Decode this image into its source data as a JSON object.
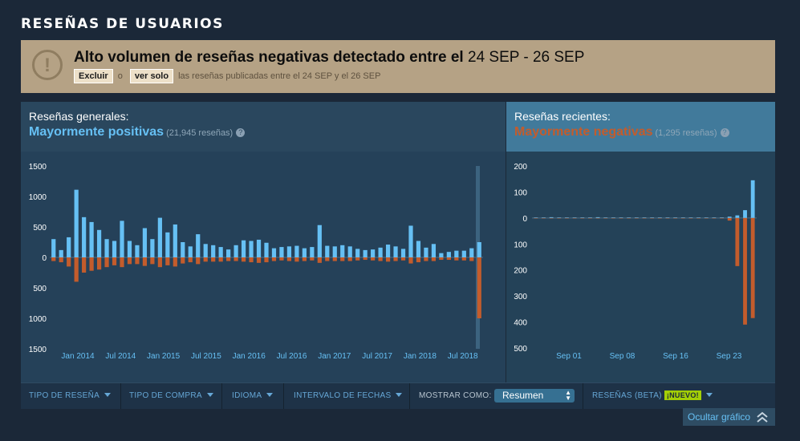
{
  "section_title": "RESEÑAS DE USUARIOS",
  "alert": {
    "title_bold": "Alto volumen de reseñas negativas detectado entre el",
    "title_dates": "24 SEP - 26 SEP",
    "exclude_label": "Excluir",
    "or_label": "o",
    "only_label": "ver solo",
    "suffix": "las reseñas publicadas entre el 24 SEP y el 26 SEP",
    "icon": "exclamation-icon"
  },
  "overall": {
    "label": "Reseñas generales:",
    "summary": "Mayormente positivas",
    "count": "(21,945 reseñas)",
    "help": "?"
  },
  "recent": {
    "label": "Reseñas recientes:",
    "summary": "Mayormente negativas",
    "count": "(1,295 reseñas)",
    "help": "?"
  },
  "colors": {
    "positive": "#66c0f4",
    "negative": "#c35c2c",
    "overall_summary": "#66c0f4",
    "recent_summary": "#c35c2c",
    "new_badge": "#a3cf06"
  },
  "filters": {
    "review_type": "TIPO DE RESEÑA",
    "purchase_type": "TIPO DE COMPRA",
    "language": "IDIOMA",
    "date_range": "INTERVALO DE FECHAS",
    "display_as": "MOSTRAR COMO:",
    "display_value": "Resumen",
    "beta_reviews": "RESEÑAS (BETA)",
    "new_badge": "¡NUEVO!"
  },
  "hide_graph": "Ocultar gráfico",
  "chart_data": [
    {
      "type": "bar",
      "title": "",
      "yticks": [
        "1500",
        "1000",
        "500",
        "0",
        "500",
        "1000",
        "1500"
      ],
      "ylim": [
        -1500,
        1500
      ],
      "xlabels": [
        "Jan 2014",
        "Jul 2014",
        "Jan 2015",
        "Jul 2015",
        "Jan 2016",
        "Jul 2016",
        "Jan 2017",
        "Jul 2017",
        "Jan 2018",
        "Jul 2018"
      ],
      "series": [
        {
          "values": [
            300,
            120,
            330,
            1110,
            660,
            580,
            450,
            300,
            270,
            600,
            270,
            200,
            480,
            300,
            650,
            410,
            540,
            250,
            180,
            380,
            220,
            200,
            170,
            130,
            200,
            280,
            270,
            290,
            240,
            150,
            170,
            180,
            190,
            150,
            170,
            530,
            190,
            180,
            200,
            180,
            140,
            120,
            130,
            160,
            210,
            180,
            140,
            520,
            270,
            160,
            220,
            70,
            90,
            110,
            110,
            150,
            250
          ]
        },
        {
          "values": [
            -60,
            -80,
            -150,
            -400,
            -250,
            -220,
            -200,
            -160,
            -130,
            -160,
            -110,
            -110,
            -140,
            -110,
            -160,
            -130,
            -150,
            -100,
            -80,
            -110,
            -70,
            -70,
            -70,
            -60,
            -60,
            -70,
            -80,
            -90,
            -80,
            -60,
            -50,
            -60,
            -70,
            -60,
            -50,
            -90,
            -60,
            -60,
            -60,
            -60,
            -50,
            -40,
            -50,
            -60,
            -70,
            -60,
            -50,
            -100,
            -80,
            -60,
            -60,
            -40,
            -40,
            -50,
            -50,
            -60,
            -1000
          ]
        }
      ]
    },
    {
      "type": "bar",
      "title": "",
      "yticks": [
        "200",
        "100",
        "0",
        "100",
        "200",
        "300",
        "400",
        "500"
      ],
      "ylim": [
        -500,
        200
      ],
      "xlabels": [
        "Sep 01",
        "Sep 08",
        "Sep 16",
        "Sep 23"
      ],
      "series": [
        {
          "values": [
            2,
            2,
            3,
            2,
            2,
            2,
            2,
            2,
            3,
            2,
            2,
            2,
            2,
            2,
            2,
            2,
            2,
            2,
            2,
            2,
            2,
            2,
            2,
            2,
            2,
            5,
            10,
            30,
            145
          ]
        },
        {
          "values": [
            -1,
            -1,
            -1,
            -1,
            -1,
            -1,
            -1,
            -1,
            -1,
            -1,
            -1,
            -1,
            -1,
            -1,
            -1,
            -1,
            -1,
            -1,
            -1,
            -1,
            -1,
            -1,
            -1,
            -1,
            -1,
            -10,
            -185,
            -410,
            -385
          ]
        }
      ]
    }
  ]
}
